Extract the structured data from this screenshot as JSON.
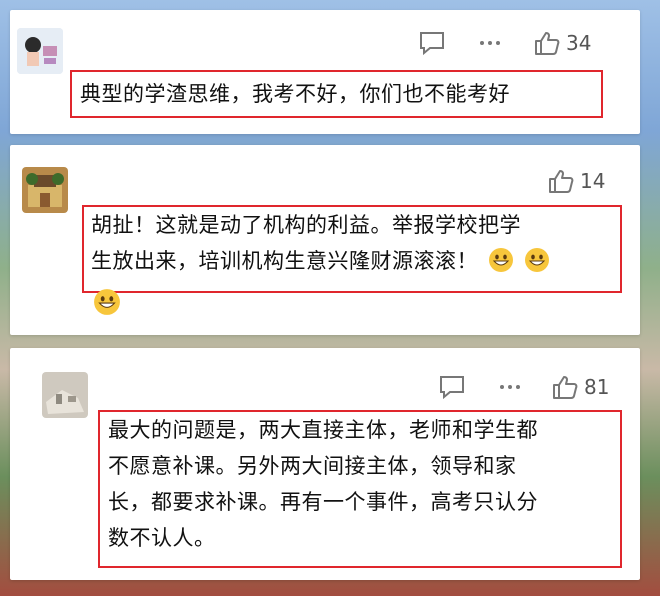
{
  "comments": [
    {
      "avatar": "woman-avatar-icon",
      "likes": "34",
      "has_reply_icon": true,
      "text": "典型的学渣思维，我考不好，你们也不能考好",
      "emojis": 0
    },
    {
      "avatar": "building-avatar-icon",
      "likes": "14",
      "has_reply_icon": false,
      "text_lines": [
        "胡扯！这就是动了机构的利益。举报学校把学",
        "生放出来，培训机构生意兴隆财源滚滚！"
      ],
      "emojis": 3,
      "emoji_name": "grinning-face-emoji"
    },
    {
      "avatar": "abstract-avatar-icon",
      "likes": "81",
      "has_reply_icon": true,
      "text_lines": [
        "最大的问题是，两大直接主体，老师和学生都",
        "不愿意补课。另外两大间接主体，领导和家",
        "长，都要求补课。再有一个事件，高考只认分",
        "数不认人。"
      ],
      "emojis": 0
    }
  ],
  "colors": {
    "highlight_border": "#e0262d",
    "card_bg": "#ffffff"
  }
}
